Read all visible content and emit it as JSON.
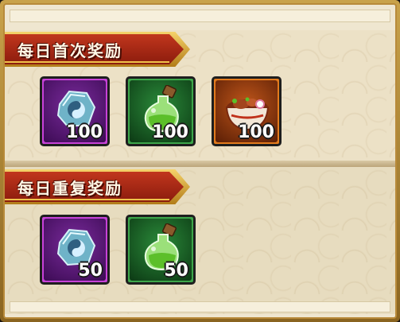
{
  "sections": [
    {
      "title": "每日首次奖励",
      "items": [
        {
          "icon": "spirit-stone-icon",
          "quality": "purple",
          "count": "100"
        },
        {
          "icon": "green-potion-icon",
          "quality": "green",
          "count": "100"
        },
        {
          "icon": "ramen-bowl-icon",
          "quality": "orange",
          "count": "100"
        }
      ]
    },
    {
      "title": "每日重复奖励",
      "items": [
        {
          "icon": "spirit-stone-icon",
          "quality": "purple",
          "count": "50"
        },
        {
          "icon": "green-potion-icon",
          "quality": "green",
          "count": "50"
        }
      ]
    }
  ],
  "colors": {
    "banner": "#a8281a",
    "panel": "#efe6d0",
    "quality_purple": "#c742d8",
    "quality_green": "#3da64a",
    "quality_orange": "#e37b1d"
  }
}
